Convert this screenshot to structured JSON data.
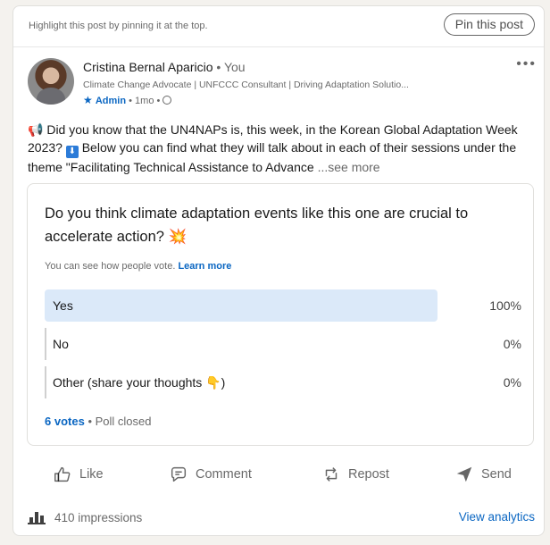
{
  "pin": {
    "hint": "Highlight this post by pinning it at the top.",
    "button_label": "Pin this post"
  },
  "author": {
    "name": "Cristina Bernal Aparicio",
    "separator": "•",
    "relation": "You",
    "headline": "Climate Change Advocate | UNFCCC Consultant | Driving Adaptation Solutio...",
    "role": "Admin",
    "age": "1mo",
    "more_icon": "more-dots-icon"
  },
  "post": {
    "text_part1": " Did you know that the UN4NAPs is, this week, in the Korean Global Adaptation Week 2023? ",
    "text_part2": " Below you can find what they will talk about in each of their sessions under the theme \"Facilitating Technical Assistance to Advance",
    "see_more": "...see more"
  },
  "poll": {
    "question": "Do you think climate adaptation events like this one are crucial to accelerate action?",
    "visibility": "You can see how people vote.",
    "learn_more": "Learn more",
    "options": [
      {
        "label": "Yes",
        "percent": "100%",
        "share": 1.0,
        "selected": true
      },
      {
        "label": "No",
        "percent": "0%",
        "share": 0.0,
        "selected": false
      },
      {
        "label": "Other (share your thoughts ",
        "percent": "0%",
        "share": 0.0,
        "selected": false
      }
    ],
    "votes": "6 votes",
    "status": "Poll closed"
  },
  "actions": [
    {
      "label": "Like",
      "icon": "like-icon"
    },
    {
      "label": "Comment",
      "icon": "comment-icon"
    },
    {
      "label": "Repost",
      "icon": "repost-icon"
    },
    {
      "label": "Send",
      "icon": "send-icon"
    }
  ],
  "stats": {
    "impressions": "410 impressions",
    "view_analytics": "View analytics"
  },
  "colors": {
    "accent": "#0a66c2",
    "poll_bar": "#dbe9f9"
  }
}
